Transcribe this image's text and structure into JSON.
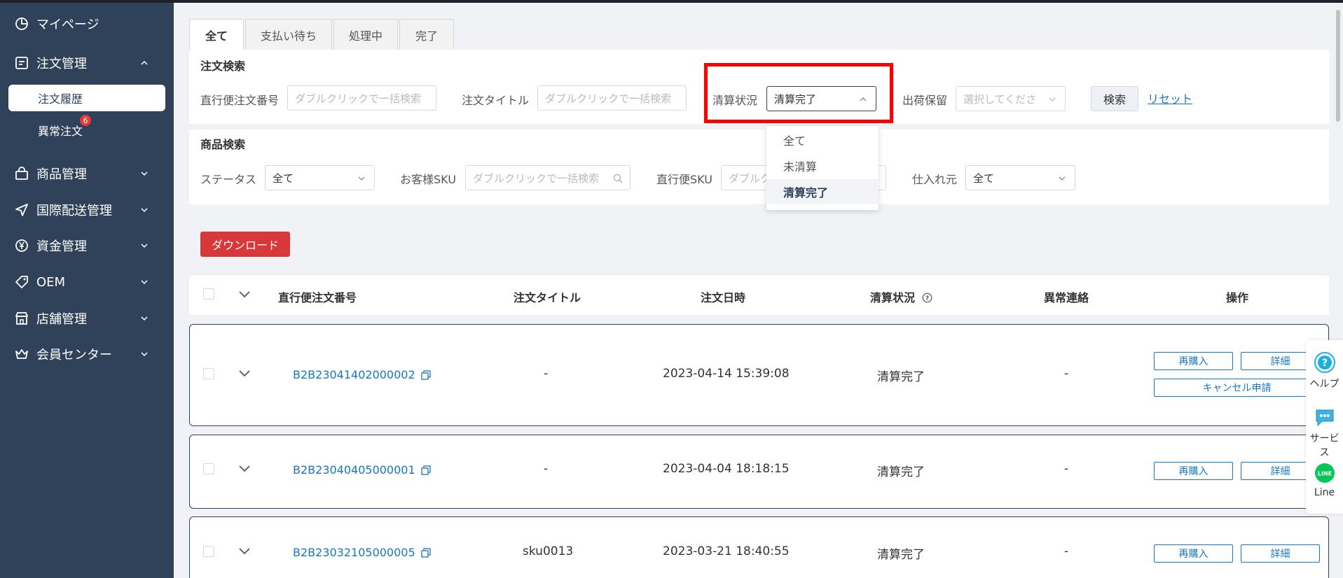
{
  "sidebar": {
    "items": [
      {
        "label": "マイページ",
        "icon": "dashboard-icon"
      },
      {
        "label": "注文管理",
        "icon": "document-icon",
        "expanded": true
      },
      {
        "label": "商品管理",
        "icon": "bag-icon"
      },
      {
        "label": "国際配送管理",
        "icon": "send-icon"
      },
      {
        "label": "資金管理",
        "icon": "yen-icon"
      },
      {
        "label": "OEM",
        "icon": "tag-icon"
      },
      {
        "label": "店舗管理",
        "icon": "store-icon"
      },
      {
        "label": "会員センター",
        "icon": "crown-icon"
      }
    ],
    "sub_items": [
      {
        "label": "注文履歴",
        "active": true
      },
      {
        "label": "異常注文",
        "badge": "6"
      }
    ]
  },
  "tabs": [
    "全て",
    "支払い待ち",
    "処理中",
    "完了"
  ],
  "order_search": {
    "title": "注文検索",
    "order_no_label": "直行便注文番号",
    "order_no_placeholder": "ダブルクリックで一括検索",
    "order_title_label": "注文タイトル",
    "order_title_placeholder": "ダブルクリックで一括検索",
    "settlement_label": "清算状況",
    "settlement_value": "清算完了",
    "hold_label": "出荷保留",
    "hold_placeholder": "選択してくださ",
    "search_button": "検索",
    "reset_link": "リセット"
  },
  "settlement_dropdown": {
    "options": [
      "全て",
      "未清算",
      "清算完了"
    ],
    "selected": "清算完了"
  },
  "product_search": {
    "title": "商品検索",
    "status_label": "ステータス",
    "status_value": "全て",
    "customer_sku_label": "お客様SKU",
    "customer_sku_placeholder": "ダブルクリックで一括検索",
    "direct_sku_label": "直行便SKU",
    "direct_sku_placeholder": "ダブルクリ",
    "supplier_label": "仕入れ元",
    "supplier_value": "全て"
  },
  "download_button": "ダウンロード",
  "table": {
    "headers": {
      "order_no": "直行便注文番号",
      "title": "注文タイトル",
      "date": "注文日時",
      "settlement": "清算状況",
      "anomaly": "異常連絡",
      "actions": "操作"
    },
    "rows": [
      {
        "order_no": "B2B23041402000002",
        "title": "-",
        "date": "2023-04-14 15:39:08",
        "settlement": "清算完了",
        "anomaly": "-"
      },
      {
        "order_no": "B2B23040405000001",
        "title": "-",
        "date": "2023-04-04 18:18:15",
        "settlement": "清算完了",
        "anomaly": "-"
      },
      {
        "order_no": "B2B23032105000005",
        "title": "sku0013",
        "date": "2023-03-21 18:40:55",
        "settlement": "清算完了",
        "anomaly": "-"
      }
    ],
    "btn_rebuy": "再購入",
    "btn_detail": "詳細",
    "btn_cancel": "キャンセル申請"
  },
  "float": {
    "help": "ヘルプ",
    "service": "サービス",
    "line": "Line",
    "line_logo": "LINE"
  },
  "colors": {
    "sidebar_bg": "#2f4259",
    "link": "#1677c7",
    "danger": "#d9383a",
    "highlight": "#ff0000"
  }
}
